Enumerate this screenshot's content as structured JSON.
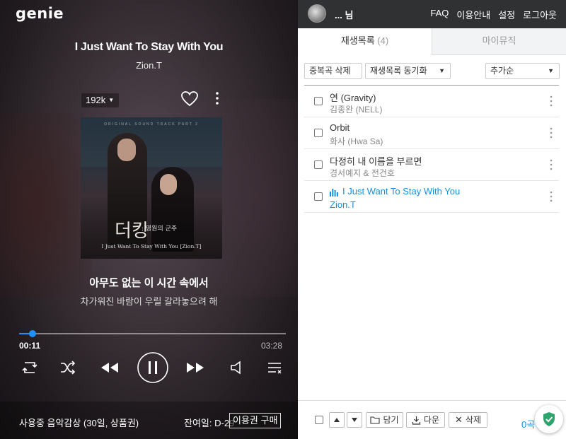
{
  "app": {
    "logo": "genie"
  },
  "player": {
    "title": "I Just Want To Stay With You",
    "artist": "Zion.T",
    "quality": "192k",
    "album_art": {
      "header": "ORIGINAL SOUND TRACK PART 2",
      "logo_main": "더킹",
      "logo_sub": ": 영원의 군주",
      "caption": "I Just Want To Stay With You [Zion.T]"
    },
    "lyric_current": "아무도 없는 이 시간 속에서",
    "lyric_next": "차가워진 바람이 우릴 갈라놓으려 해",
    "time_current": "00:11",
    "time_total": "03:28",
    "progress_fraction": 0.05,
    "ticket_status": "사용중 음악감상 (30일, 상품권)",
    "remaining_days": "잔여일: D-29",
    "buy_label": "이용권 구매",
    "accent_color": "#1e90ff"
  },
  "header": {
    "username": "... 님",
    "links": [
      "FAQ",
      "이용안내",
      "설정",
      "로그아웃"
    ]
  },
  "tabs": {
    "playlist_label": "재생목록",
    "playlist_count": "(4)",
    "mymusic_label": "마이뮤직"
  },
  "toolbar": {
    "dedupe_label": "중복곡 삭제",
    "sync_label": "재생목록 동기화",
    "sort_label": "추가순"
  },
  "playlist": [
    {
      "title": "연 (Gravity)",
      "artist": "김종완 (NELL)",
      "active": false
    },
    {
      "title": "Orbit",
      "artist": "화사 (Hwa Sa)",
      "active": false
    },
    {
      "title": "다정히 내 이름을 부르면",
      "artist": "경서예지 & 전건호",
      "active": false
    },
    {
      "title": "I Just Want To Stay With You",
      "artist": "Zion.T",
      "active": true
    }
  ],
  "footer": {
    "save_label": "담기",
    "download_label": "다운",
    "delete_label": "삭제",
    "selected_count": "0곡",
    "accent_color": "#1a8fe0"
  }
}
